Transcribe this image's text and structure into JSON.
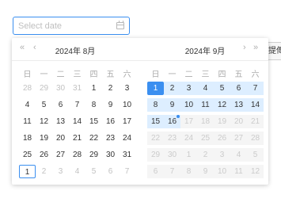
{
  "input": {
    "placeholder": "Select date",
    "value": ""
  },
  "side_button": {
    "label": "提傳"
  },
  "left_panel": {
    "title": "2024年 8月",
    "weekdays": [
      "日",
      "一",
      "二",
      "三",
      "四",
      "五",
      "六"
    ],
    "weeks": [
      [
        {
          "d": "28",
          "s": "other"
        },
        {
          "d": "29",
          "s": "other"
        },
        {
          "d": "30",
          "s": "other"
        },
        {
          "d": "31",
          "s": "other"
        },
        {
          "d": "1",
          "s": "cur"
        },
        {
          "d": "2",
          "s": "cur"
        },
        {
          "d": "3",
          "s": "cur"
        }
      ],
      [
        {
          "d": "4",
          "s": "cur"
        },
        {
          "d": "5",
          "s": "cur"
        },
        {
          "d": "6",
          "s": "cur"
        },
        {
          "d": "7",
          "s": "cur"
        },
        {
          "d": "8",
          "s": "cur"
        },
        {
          "d": "9",
          "s": "cur"
        },
        {
          "d": "10",
          "s": "cur"
        }
      ],
      [
        {
          "d": "11",
          "s": "cur"
        },
        {
          "d": "12",
          "s": "cur"
        },
        {
          "d": "13",
          "s": "cur"
        },
        {
          "d": "14",
          "s": "cur"
        },
        {
          "d": "15",
          "s": "cur"
        },
        {
          "d": "16",
          "s": "cur"
        },
        {
          "d": "17",
          "s": "cur"
        }
      ],
      [
        {
          "d": "18",
          "s": "cur"
        },
        {
          "d": "19",
          "s": "cur"
        },
        {
          "d": "20",
          "s": "cur"
        },
        {
          "d": "21",
          "s": "cur"
        },
        {
          "d": "22",
          "s": "cur"
        },
        {
          "d": "23",
          "s": "cur"
        },
        {
          "d": "24",
          "s": "cur"
        }
      ],
      [
        {
          "d": "25",
          "s": "cur"
        },
        {
          "d": "26",
          "s": "cur"
        },
        {
          "d": "27",
          "s": "cur"
        },
        {
          "d": "28",
          "s": "cur"
        },
        {
          "d": "29",
          "s": "cur"
        },
        {
          "d": "30",
          "s": "cur"
        },
        {
          "d": "31",
          "s": "cur"
        }
      ],
      [
        {
          "d": "1",
          "s": "today"
        },
        {
          "d": "2",
          "s": "other"
        },
        {
          "d": "3",
          "s": "other"
        },
        {
          "d": "4",
          "s": "other"
        },
        {
          "d": "5",
          "s": "other"
        },
        {
          "d": "6",
          "s": "other"
        },
        {
          "d": "7",
          "s": "other"
        }
      ]
    ]
  },
  "right_panel": {
    "title": "2024年 9月",
    "weekdays": [
      "日",
      "一",
      "二",
      "三",
      "四",
      "五",
      "六"
    ],
    "weeks": [
      [
        {
          "d": "1",
          "s": "sel"
        },
        {
          "d": "2",
          "s": "inrange"
        },
        {
          "d": "3",
          "s": "inrange"
        },
        {
          "d": "4",
          "s": "inrange"
        },
        {
          "d": "5",
          "s": "inrange"
        },
        {
          "d": "6",
          "s": "inrange"
        },
        {
          "d": "7",
          "s": "inrange"
        }
      ],
      [
        {
          "d": "8",
          "s": "inrange"
        },
        {
          "d": "9",
          "s": "inrange"
        },
        {
          "d": "10",
          "s": "inrange"
        },
        {
          "d": "11",
          "s": "inrange"
        },
        {
          "d": "12",
          "s": "inrange"
        },
        {
          "d": "13",
          "s": "inrange"
        },
        {
          "d": "14",
          "s": "inrange"
        }
      ],
      [
        {
          "d": "15",
          "s": "inrange"
        },
        {
          "d": "16",
          "s": "inrange-dot"
        },
        {
          "d": "17",
          "s": "dis"
        },
        {
          "d": "18",
          "s": "dis"
        },
        {
          "d": "19",
          "s": "dis"
        },
        {
          "d": "20",
          "s": "dis"
        },
        {
          "d": "21",
          "s": "dis"
        }
      ],
      [
        {
          "d": "22",
          "s": "dis"
        },
        {
          "d": "23",
          "s": "dis"
        },
        {
          "d": "24",
          "s": "dis"
        },
        {
          "d": "25",
          "s": "dis"
        },
        {
          "d": "26",
          "s": "dis"
        },
        {
          "d": "27",
          "s": "dis"
        },
        {
          "d": "28",
          "s": "dis"
        }
      ],
      [
        {
          "d": "29",
          "s": "dis"
        },
        {
          "d": "30",
          "s": "dis"
        },
        {
          "d": "1",
          "s": "dis"
        },
        {
          "d": "2",
          "s": "dis"
        },
        {
          "d": "3",
          "s": "dis"
        },
        {
          "d": "4",
          "s": "dis"
        },
        {
          "d": "5",
          "s": "dis"
        }
      ],
      [
        {
          "d": "6",
          "s": "dis"
        },
        {
          "d": "7",
          "s": "dis"
        },
        {
          "d": "8",
          "s": "dis"
        },
        {
          "d": "9",
          "s": "dis"
        },
        {
          "d": "10",
          "s": "dis"
        },
        {
          "d": "11",
          "s": "dis"
        },
        {
          "d": "12",
          "s": "dis"
        }
      ]
    ]
  },
  "nav_icons": {
    "prev_year": "«",
    "prev_month": "‹",
    "next_month": "›",
    "next_year": "»"
  },
  "colors": {
    "accent": "#3b8ff0",
    "range": "#ddeeff",
    "disabled_bg": "#f5f5f5"
  }
}
